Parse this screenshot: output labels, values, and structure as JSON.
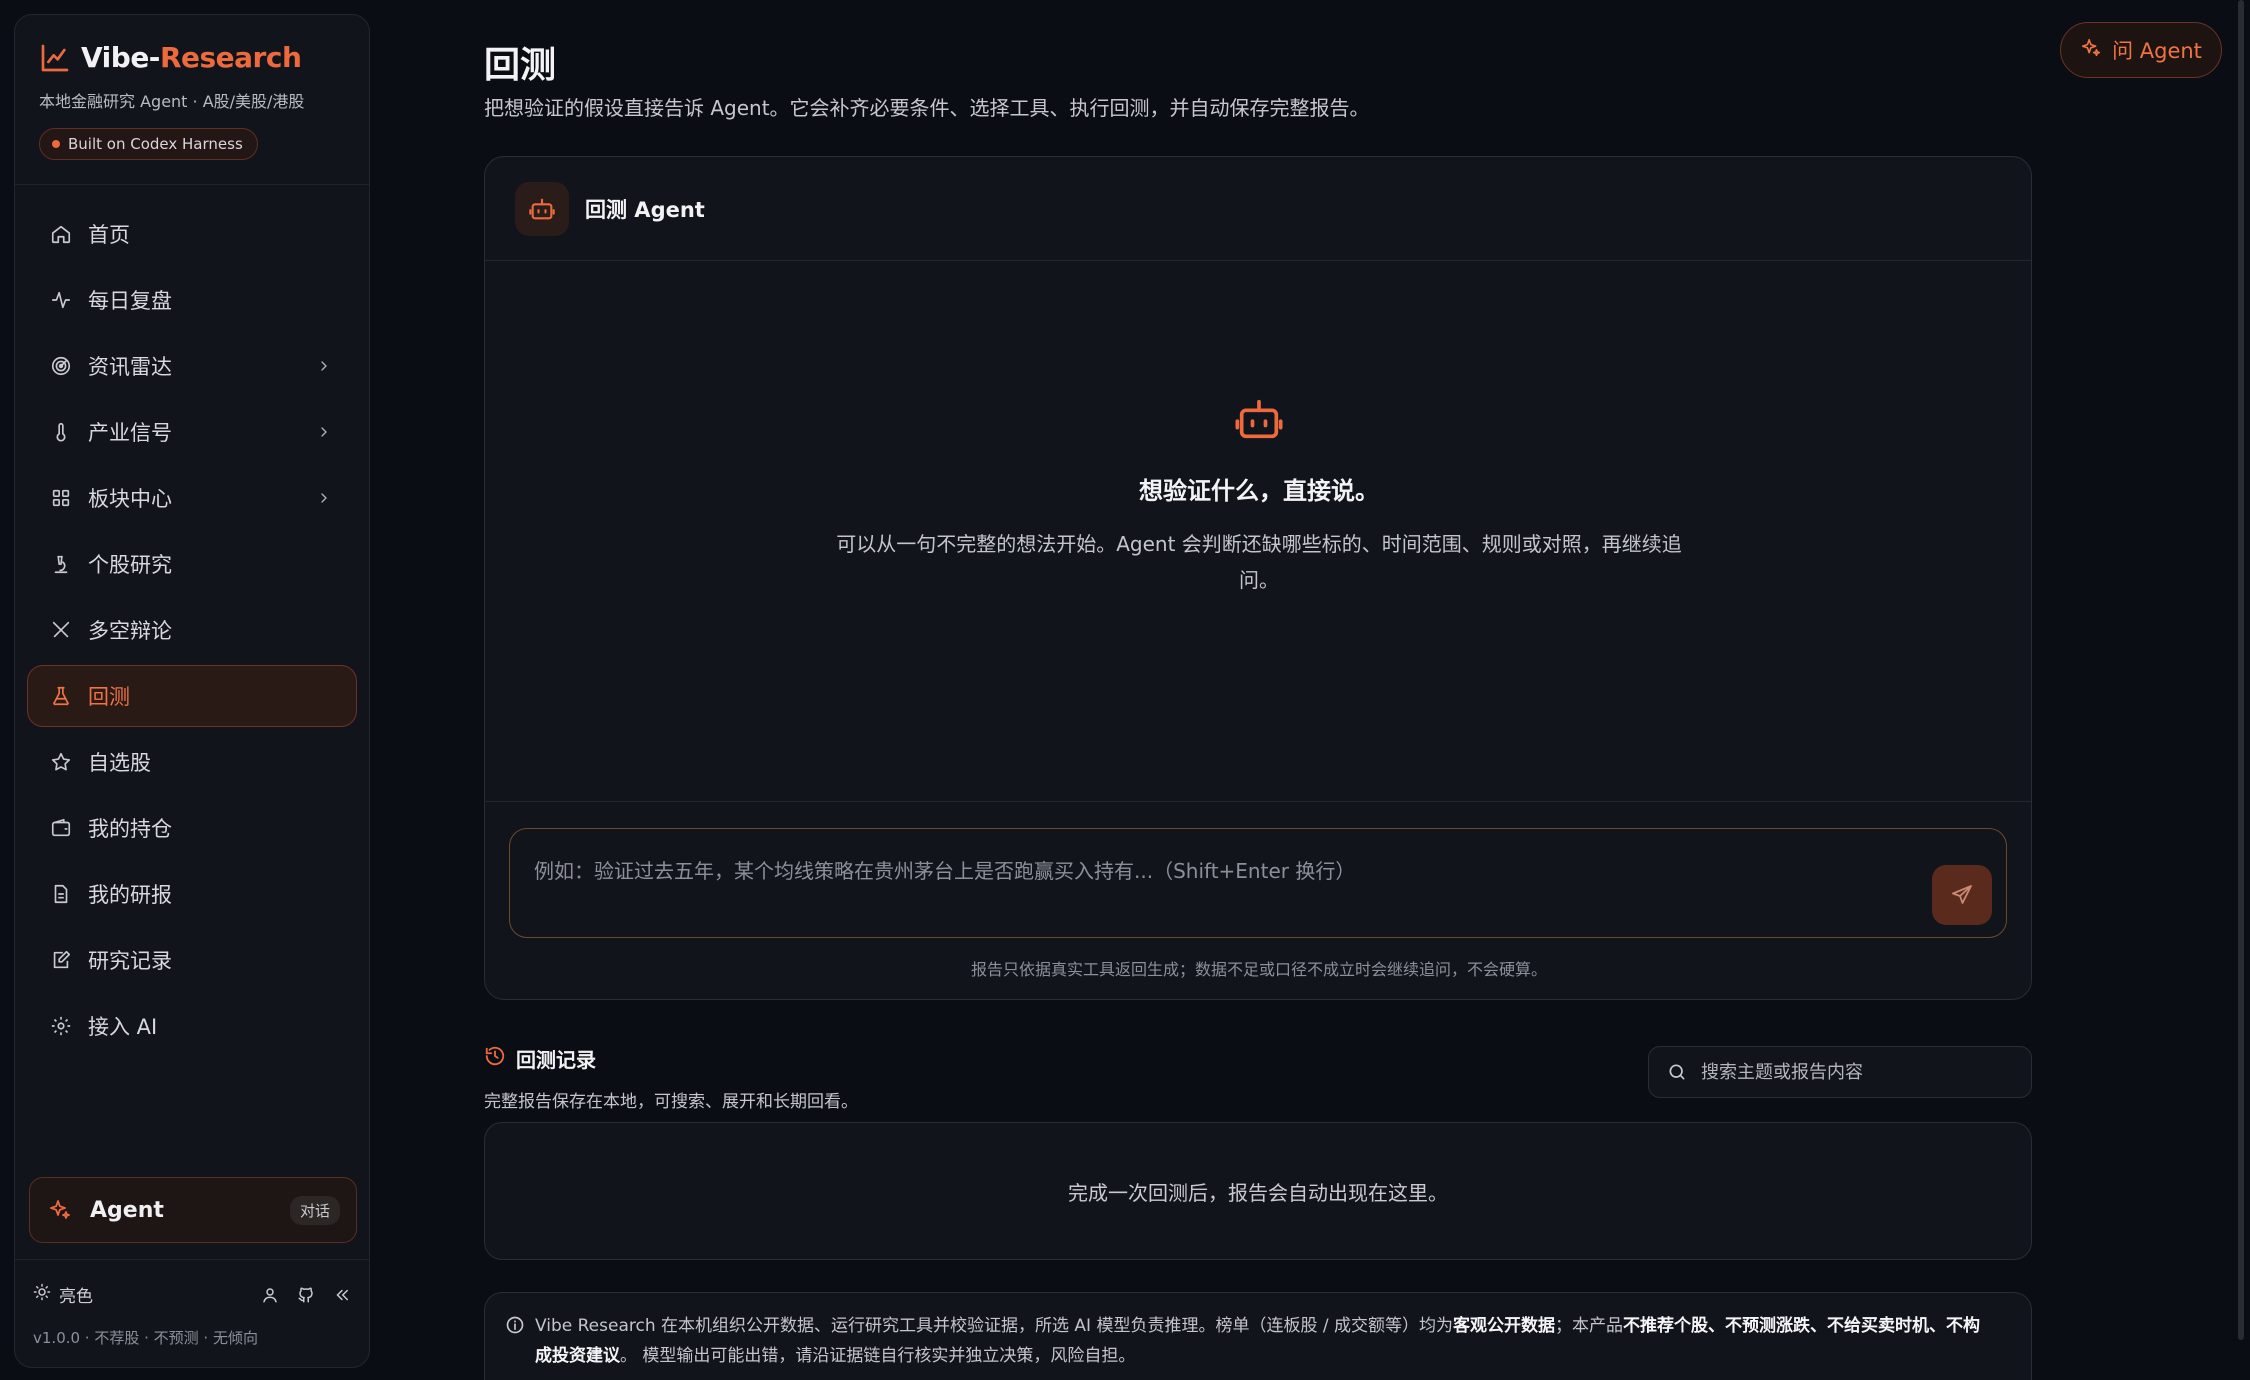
{
  "brand": {
    "name_main": "Vibe-",
    "name_accent": "Research",
    "subtitle": "本地金融研究 Agent · A股/美股/港股",
    "badge": "Built on Codex Harness"
  },
  "nav": {
    "items": [
      {
        "label": "首页",
        "icon": "home-icon"
      },
      {
        "label": "每日复盘",
        "icon": "pulse-icon"
      },
      {
        "label": "资讯雷达",
        "icon": "radar-icon",
        "has_children": true
      },
      {
        "label": "产业信号",
        "icon": "thermometer-icon",
        "has_children": true
      },
      {
        "label": "板块中心",
        "icon": "grid-icon",
        "has_children": true
      },
      {
        "label": "个股研究",
        "icon": "microscope-icon"
      },
      {
        "label": "多空辩论",
        "icon": "swords-icon"
      },
      {
        "label": "回测",
        "icon": "flask-icon",
        "active": true
      },
      {
        "label": "自选股",
        "icon": "star-icon"
      },
      {
        "label": "我的持仓",
        "icon": "wallet-icon"
      },
      {
        "label": "我的研报",
        "icon": "document-icon"
      },
      {
        "label": "研究记录",
        "icon": "edit-icon"
      },
      {
        "label": "接入 AI",
        "icon": "gear-icon"
      }
    ]
  },
  "sidebar_agent": {
    "label": "Agent",
    "tag": "对话"
  },
  "sidebar_footer": {
    "theme_label": "亮色",
    "version": "v1.0.0 · 不荐股 · 不预测 · 无倾向"
  },
  "header": {
    "title": "回测",
    "description": "把想验证的假设直接告诉 Agent。它会补齐必要条件、选择工具、执行回测，并自动保存完整报告。",
    "ask_agent": "问 Agent"
  },
  "agent_card": {
    "name": "回测 Agent",
    "empty_title": "想验证什么，直接说。",
    "empty_body": "可以从一句不完整的想法开始。Agent 会判断还缺哪些标的、时间范围、规则或对照，再继续追问。",
    "input_placeholder": "例如：验证过去五年，某个均线策略在贵州茅台上是否跑赢买入持有...（Shift+Enter 换行）",
    "input_value": "",
    "hint": "报告只依据真实工具返回生成；数据不足或口径不成立时会继续追问，不会硬算。"
  },
  "records": {
    "title": "回测记录",
    "subtitle": "完整报告保存在本地，可搜索、展开和长期回看。",
    "search_placeholder": "搜索主题或报告内容",
    "empty": "完成一次回测后，报告会自动出现在这里。"
  },
  "disclaimer": {
    "part1": "Vibe Research 在本机组织公开数据、运行研究工具并校验证据，所选 AI 模型负责推理。榜单（连板股 / 成交额等）均为",
    "bold1": "客观公开数据",
    "part2": "；本产品",
    "bold2": "不推荐个股、不预测涨跌、不给买卖时机、不构成投资建议",
    "part3": "。 模型输出可能出错，请沿证据链自行核实并独立决策，风险自担。"
  },
  "colors": {
    "accent": "#ec6a3d",
    "background": "#0b0d14",
    "panel": "#12141c"
  }
}
